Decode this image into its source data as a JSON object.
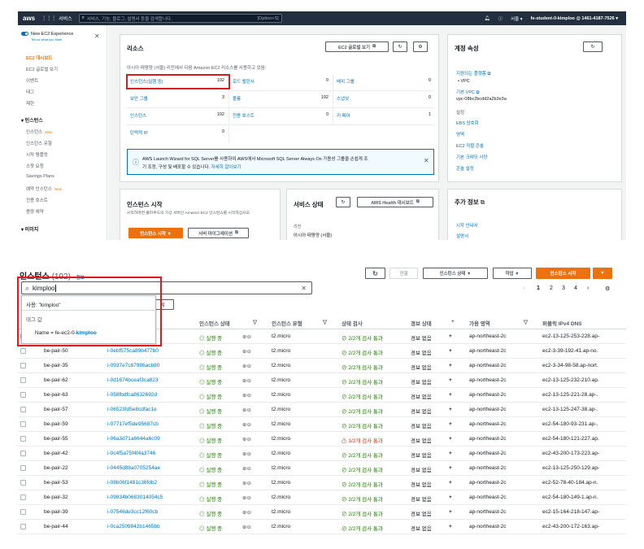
{
  "topnav": {
    "logo": "aws",
    "services_label": "서비스",
    "search_placeholder": "서비스, 기능, 블로그, 설명서 등을 검색합니다.",
    "search_shortcut": "[Option+S]",
    "region": "서울 ▾",
    "account": "fe-student-0-kimploo @ 1461-4187-7526 ▾",
    "icons": [
      "bell-icon",
      "help-icon"
    ]
  },
  "sidebar": {
    "experience_label": "New EC2 Experience",
    "experience_sub": "Tell us what you think",
    "items": [
      "EC2 대시보드",
      "EC2 글로벌 보기",
      "이벤트",
      "태그",
      "제한"
    ],
    "section_instances": "▾ 인스턴스",
    "instance_items": [
      "인스턴스",
      "인스턴스 유형",
      "시작 템플릿",
      "스팟 요청",
      "Savings Plans",
      "예약 인스턴스",
      "전용 호스트",
      "용량 예약"
    ],
    "new_badge": "New",
    "section_images": "▾ 이미지"
  },
  "resources": {
    "title": "리소스",
    "global_view_btn": "EC2 글로벌 보기",
    "desc": "아시아 태평양 (서울) 리전에서 다음 Amazon EC2 리소스를 사용하고 있음:",
    "cells": [
      {
        "name": "인스턴스(실행 중)",
        "count": "192"
      },
      {
        "name": "탄력적 IP",
        "count": "0"
      },
      {
        "name": "보안 그룹",
        "count": "3"
      },
      {
        "name": "인스턴스",
        "count": "192"
      },
      {
        "name": "전용 호스트",
        "count": "0"
      },
      {
        "name": "로드 밸런서",
        "count": "0"
      },
      {
        "name": "볼륨",
        "count": "192"
      },
      {
        "name": "배치 그룹",
        "count": "0"
      },
      {
        "name": "스냅샷",
        "count": "0"
      },
      {
        "name": "키 페어",
        "count": "1"
      }
    ],
    "info_text_1": "AWS Launch Wizard for SQL Server를 사용하여 AWS에서 Microsoft SQL Server Always On 가용성 그룹을 손쉽게 조",
    "info_text_2": "기 조정, 구성 및 배포할 수 있습니다.",
    "info_link": "자세히 알아보기"
  },
  "account_attrs": {
    "title": "계정 속성",
    "supported_platforms": "지원되는 플랫폼",
    "vpc": "• VPC",
    "default_vpc": "기본 VPC",
    "vpc_id": "vpc-08bc2bcdd2a2b3e3a",
    "settings": "설정",
    "links": [
      "EBS 암호화",
      "영역",
      "EC2 직렬 콘솔",
      "기본 크레딧 사양",
      "콘솔 설정"
    ]
  },
  "launch": {
    "title": "인스턴스 시작",
    "desc": "시작하려면 클라우드의 가상 서버인 Amazon EC2 인스턴스를 시작하십시오.",
    "launch_btn": "인스턴스 시작 ▼",
    "migrate_btn": "서버 마이그레이션"
  },
  "service_health": {
    "title": "서비스 상태",
    "health_btn": "AWS Health 대시보드",
    "region_label": "리전",
    "region_value": "아시아 태평양 (서울)"
  },
  "extra_info": {
    "title": "추가 정보",
    "links": [
      "시작 안내서",
      "설명서"
    ]
  },
  "instances": {
    "title": "인스턴스",
    "count": "(192)",
    "info": "정보",
    "connect_btn": "연결",
    "state_btn": "인스턴스 상태 ▼",
    "actions_btn": "작업 ▼",
    "launch_btn": "인스턴스 시작",
    "search_value": "kimploo",
    "dropdown": {
      "use": "사용: \"kimploo\"",
      "tag_values": "태그 값",
      "tag_match_prefix": "Name = fe-ec2-0-",
      "tag_match_hl": "kimploo"
    },
    "chip_fragment": "지",
    "pages": [
      "1",
      "2",
      "3",
      "4"
    ],
    "columns": [
      "인스턴스 상태",
      "인스턴스 유형",
      "상태 검사",
      "경보 상태",
      "가용 영역",
      "퍼블릭 IPv4 DNS"
    ],
    "rows": [
      {
        "name": "",
        "id": "…aa8",
        "state": "실행 중",
        "type": "t2.micro",
        "check": "2/2개 검사 통과",
        "check_warn": false,
        "alarm": "경보 없음",
        "az": "ap-northeast-2c",
        "dns": "ec2-13-125-253-228.ap-"
      },
      {
        "name": "be-pair-50",
        "id": "i-0ebf575ca89b477b0",
        "state": "실행 중",
        "type": "t2.micro",
        "check": "2/2개 검사 통과",
        "check_warn": false,
        "alarm": "경보 없음",
        "az": "ap-northeast-2c",
        "dns": "ec2-3-39-192-41.ap-no."
      },
      {
        "name": "be-pair-35",
        "id": "i-0937e7c87986acb80",
        "state": "실행 중",
        "type": "t2.micro",
        "check": "2/2개 검사 통과",
        "check_warn": false,
        "alarm": "경보 없음",
        "az": "ap-northeast-2c",
        "dns": "ec2-3-34-98-58.ap-nort."
      },
      {
        "name": "be-pair-62",
        "id": "i-0d1674bceaf3ca823",
        "state": "실행 중",
        "type": "t2.micro",
        "check": "2/2개 검사 통과",
        "check_warn": false,
        "alarm": "경보 없음",
        "az": "ap-northeast-2c",
        "dns": "ec2-13-125-232-210.ap."
      },
      {
        "name": "be-pair-63",
        "id": "i-058fbdfca8632692d",
        "state": "실행 중",
        "type": "t2.micro",
        "check": "2/2개 검사 통과",
        "check_warn": false,
        "alarm": "경보 없음",
        "az": "ap-northeast-2c",
        "dns": "ec2-13-125-221-28.ap-."
      },
      {
        "name": "be-pair-57",
        "id": "i-06523fd5e8cdfac1e",
        "state": "실행 중",
        "type": "t2.micro",
        "check": "2/2개 검사 통과",
        "check_warn": false,
        "alarm": "경보 없음",
        "az": "ap-northeast-2c",
        "dns": "ec2-13-125-247-38.ap-."
      },
      {
        "name": "be-pair-59",
        "id": "i-07717ef5de95687cb",
        "state": "실행 중",
        "type": "t2.micro",
        "check": "2/2개 검사 통과",
        "check_warn": false,
        "alarm": "경보 없음",
        "az": "ap-northeast-2c",
        "dns": "ec2-54-180-93-231.ap-."
      },
      {
        "name": "be-pair-55",
        "id": "i-06a3d71a6644a6c09",
        "state": "실행 중",
        "type": "t2.micro",
        "check": "1/2개 검사 통과",
        "check_warn": true,
        "alarm": "경보 없음",
        "az": "ap-northeast-2c",
        "dns": "ec2-54-180-121-227.ap."
      },
      {
        "name": "be-pair-42",
        "id": "i-0c4f5a75f4f4a3746",
        "state": "실행 중",
        "type": "t2.micro",
        "check": "2/2개 검사 통과",
        "check_warn": false,
        "alarm": "경보 없음",
        "az": "ap-northeast-2c",
        "dns": "ec2-43-200-173-223.ap-"
      },
      {
        "name": "be-pair-22",
        "id": "i-0445d88a0705254ae",
        "state": "실행 중",
        "type": "t2.micro",
        "check": "2/2개 검사 통과",
        "check_warn": false,
        "alarm": "경보 없음",
        "az": "ap-northeast-2c",
        "dns": "ec2-13-125-250-129.ap-"
      },
      {
        "name": "be-pair-53",
        "id": "i-08b06f1481c36fdb2",
        "state": "실행 중",
        "type": "t2.micro",
        "check": "2/2개 검사 통과",
        "check_warn": false,
        "alarm": "경보 없음",
        "az": "ap-northeast-2c",
        "dns": "ec2-52-78-40-184.ap-n."
      },
      {
        "name": "be-pair-32",
        "id": "i-09834b0683014054c5",
        "state": "실행 중",
        "type": "t2.micro",
        "check": "2/2개 검사 통과",
        "check_warn": false,
        "alarm": "경보 없음",
        "az": "ap-northeast-2c",
        "dns": "ec2-54-180-149-1.ap-n."
      },
      {
        "name": "be-pair-39",
        "id": "i-07546de3cc12f60cb",
        "state": "실행 중",
        "type": "t2.micro",
        "check": "2/2개 검사 통과",
        "check_warn": false,
        "alarm": "경보 없음",
        "az": "ap-northeast-2c",
        "dns": "ec2-15-164-218-147.ap-"
      },
      {
        "name": "be-pair-44",
        "id": "i-0ca2509842b1465bb",
        "state": "실행 중",
        "type": "t2.micro",
        "check": "2/2개 검사 통과",
        "check_warn": false,
        "alarm": "경보 없음",
        "az": "ap-northeast-2c",
        "dns": "ec2-43-200-172-163.ap-"
      }
    ]
  },
  "colors": {
    "aws_orange": "#ec7211",
    "link_blue": "#0073bb",
    "ok_green": "#1d8102",
    "warn_red": "#d13212",
    "highlight_red": "#e0191c",
    "nav_dark": "#232f3e"
  }
}
